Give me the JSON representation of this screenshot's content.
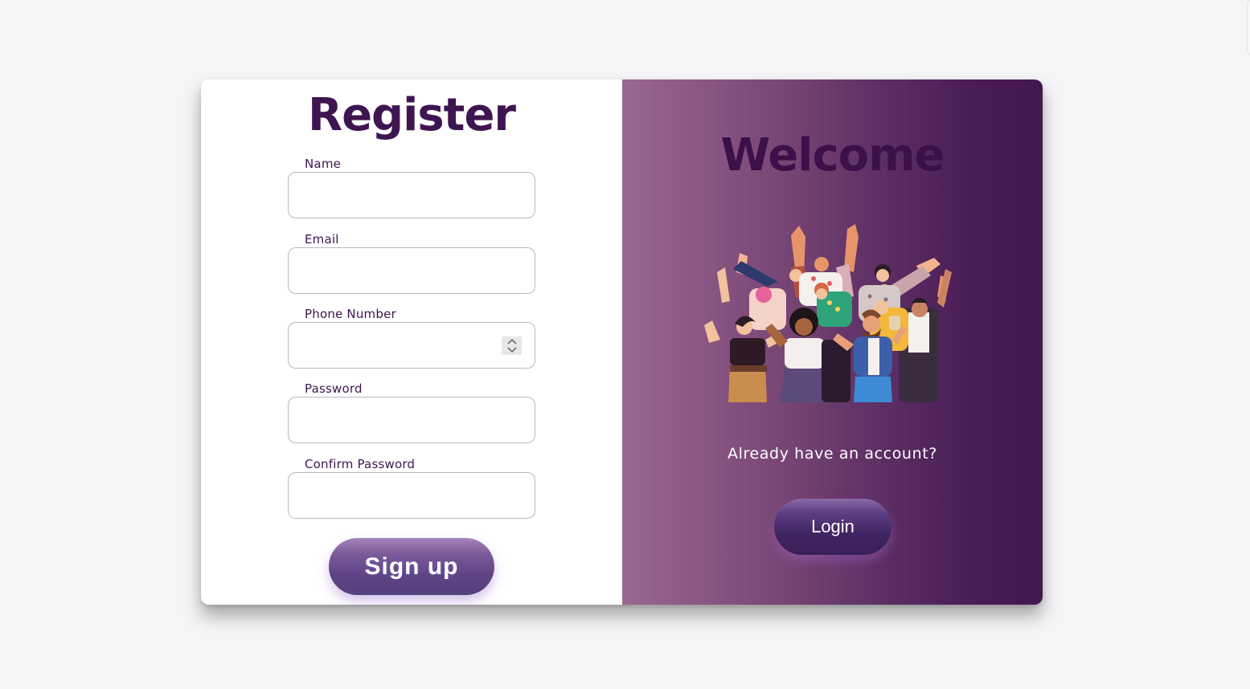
{
  "register": {
    "title": "Register",
    "fields": [
      {
        "label": "Name",
        "value": "",
        "placeholder": ""
      },
      {
        "label": "Email",
        "value": "",
        "placeholder": ""
      },
      {
        "label": "Phone Number",
        "value": "",
        "placeholder": ""
      },
      {
        "label": "Password",
        "value": "",
        "placeholder": ""
      },
      {
        "label": "Confirm Password",
        "value": "",
        "placeholder": ""
      }
    ],
    "submit_label": "Sign up"
  },
  "welcome": {
    "title": "Welcome",
    "illustration_icon": "crowd-of-people-illustration",
    "prompt": "Already have an account?",
    "login_label": "Login"
  },
  "colors": {
    "title_purple": "#3f1551",
    "panel_gradient_start": "#9a6891",
    "panel_gradient_end": "#44174f",
    "button_purple": "#5f4587"
  },
  "icons": {
    "spinner": "number-spinner-icon"
  }
}
